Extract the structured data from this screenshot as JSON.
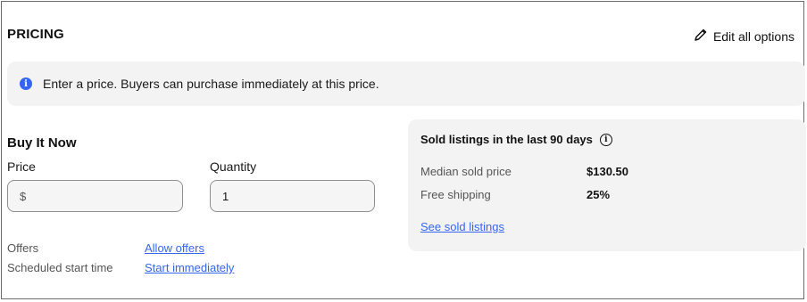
{
  "section": {
    "title": "PRICING",
    "edit_label": "Edit all options"
  },
  "banner": {
    "text": "Enter a price. Buyers can purchase immediately at this price."
  },
  "buy_it_now": {
    "title": "Buy It Now",
    "price_label": "Price",
    "price_value": "$",
    "quantity_label": "Quantity",
    "quantity_value": "1"
  },
  "options": {
    "offers_label": "Offers",
    "offers_link": "Allow offers",
    "start_label": "Scheduled start time",
    "start_link": "Start immediately"
  },
  "sold": {
    "title": "Sold listings in the last 90 days",
    "stats": [
      {
        "label": "Median sold price",
        "value": "$130.50"
      },
      {
        "label": "Free shipping",
        "value": "25%"
      }
    ],
    "link": "See sold listings"
  },
  "colors": {
    "accent": "#3665f3",
    "panel_bg": "#f3f3f3"
  }
}
